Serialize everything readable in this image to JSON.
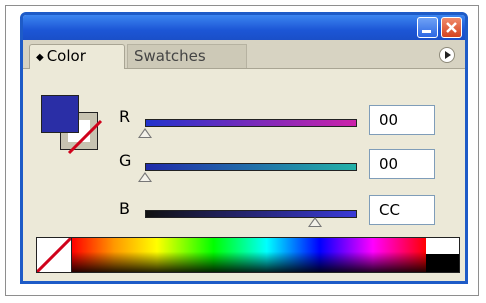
{
  "tabs": [
    {
      "label": "Color",
      "active": true
    },
    {
      "label": "Swatches",
      "active": false
    }
  ],
  "colors": {
    "fill": "#2a2ea6",
    "titlebar": "#1c56d6",
    "panel_bg": "#ece9d8"
  },
  "channels": [
    {
      "label": "R",
      "value": "00",
      "slider_fraction": 0.0
    },
    {
      "label": "G",
      "value": "00",
      "slider_fraction": 0.0
    },
    {
      "label": "B",
      "value": "CC",
      "slider_fraction": 0.8
    }
  ],
  "icons": {
    "minimize": "minimize-icon",
    "close": "close-icon",
    "options": "panel-options-icon",
    "none": "none-swatch-icon"
  }
}
